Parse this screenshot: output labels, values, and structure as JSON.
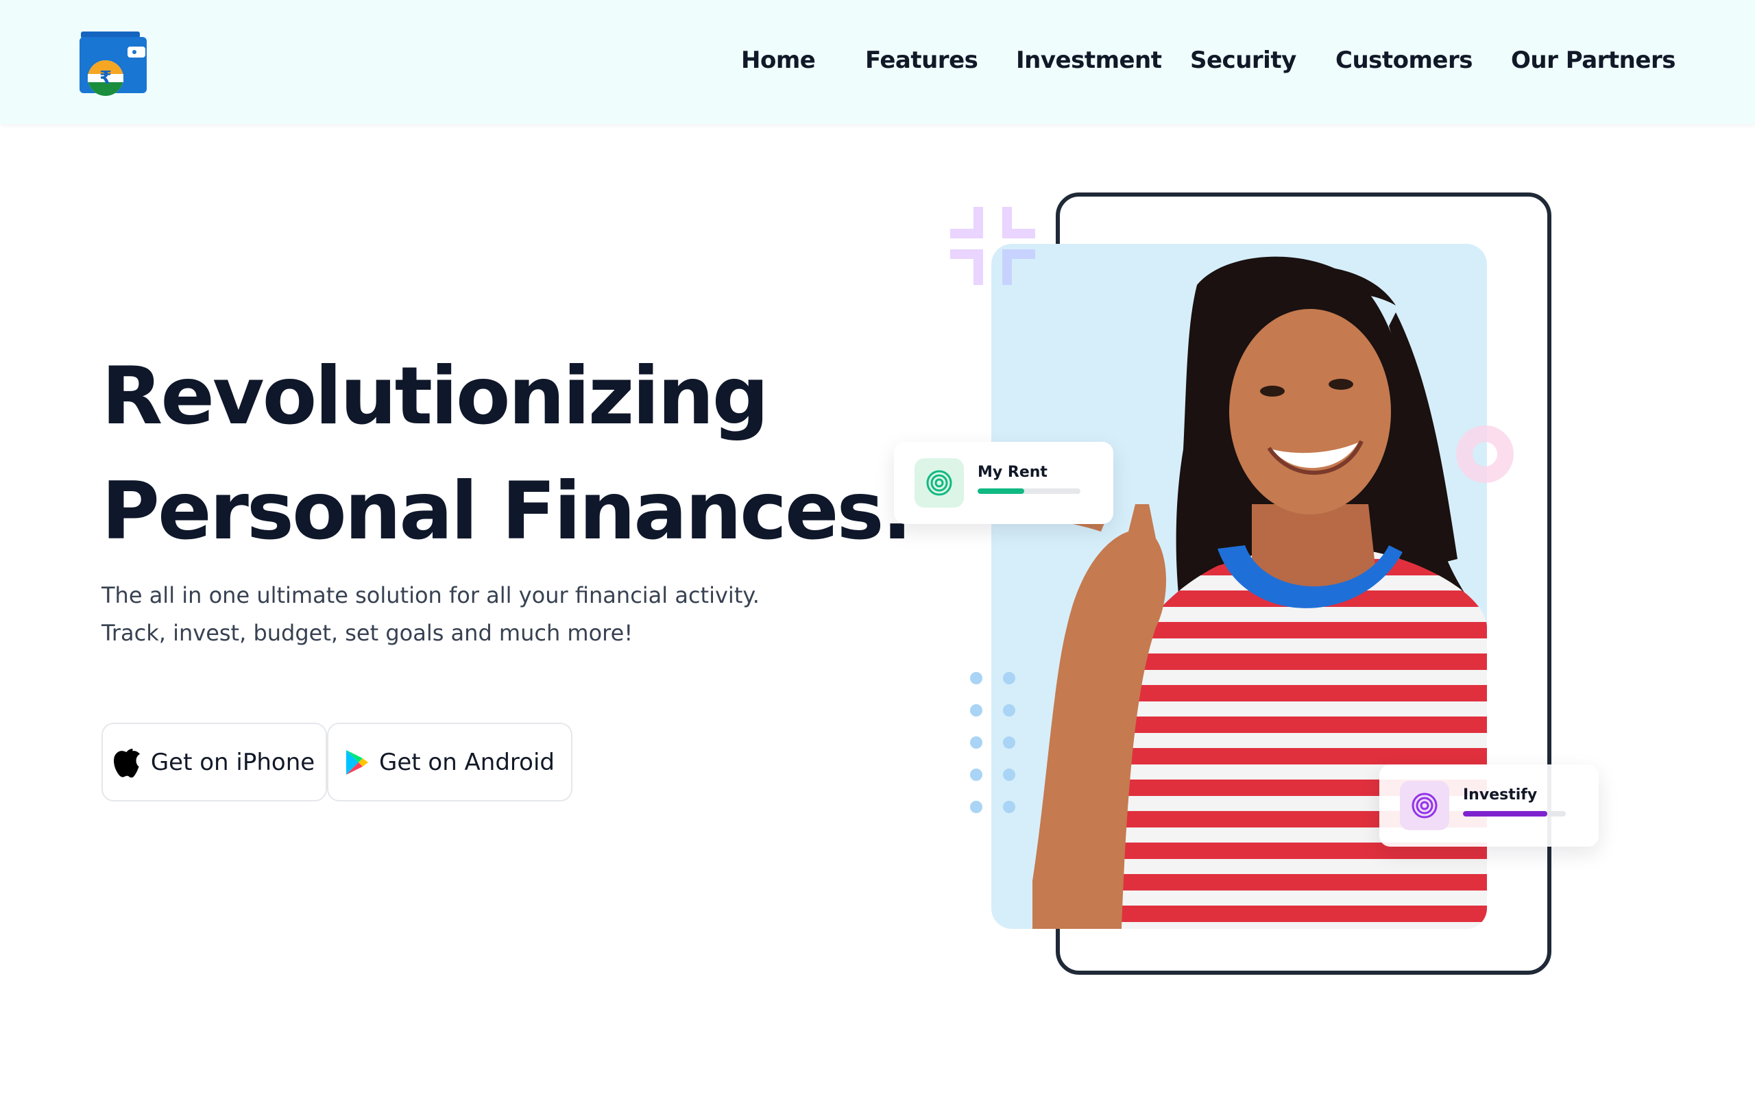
{
  "nav": {
    "items": [
      {
        "label": "Home"
      },
      {
        "label": "Features"
      },
      {
        "label": "Investment"
      },
      {
        "label": "Security"
      },
      {
        "label": "Customers"
      },
      {
        "label": "Our Partners"
      }
    ]
  },
  "hero": {
    "title_line1": "Revolutionizing",
    "title_line2": "Personal Finances.",
    "subtitle": "The all in one ultimate solution for all your financial activity. Track, invest, budget, set goals and much more!",
    "buttons": {
      "iphone": "Get on iPhone",
      "android": "Get on Android"
    }
  },
  "cards": {
    "rent": {
      "label": "My Rent",
      "progress": 0.45,
      "color": "#10b981"
    },
    "invest": {
      "label": "Investify",
      "progress": 0.82,
      "color": "#7e22ce"
    }
  },
  "icons": {
    "logo": "wallet-rupee-logo",
    "iphone": "apple-icon",
    "android": "google-play-icon",
    "rent": "target-icon",
    "invest": "target-icon"
  },
  "colors": {
    "header_bg": "#effdfd",
    "heading": "#0f172a",
    "photo_bg": "#d6eefa",
    "logo_blue": "#1565c0"
  }
}
